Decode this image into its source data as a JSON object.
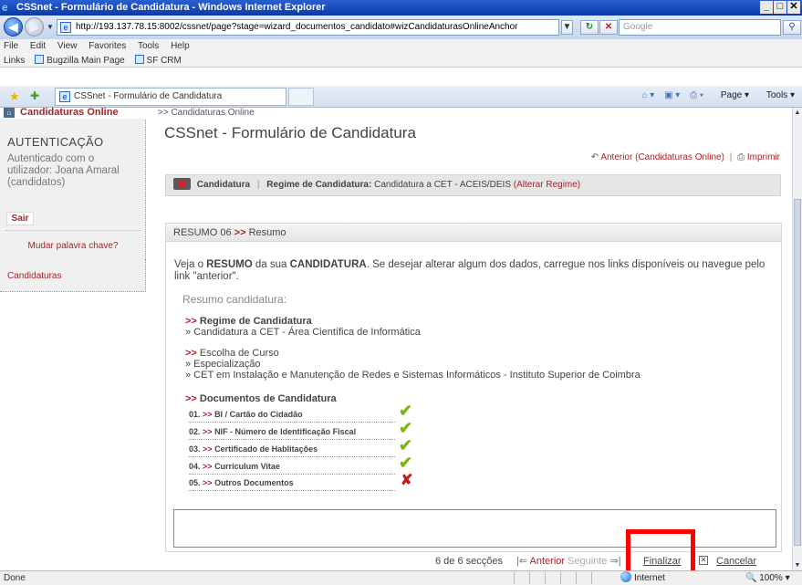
{
  "window": {
    "title": "CSSnet - Formulário de Candidatura - Windows Internet Explorer",
    "buttons": [
      "_",
      "&#x2750;",
      "X"
    ]
  },
  "browser": {
    "url": "http://193.137.78.15:8002/cssnet/page?stage=wizard_documentos_candidato#wizCandidaturasOnlineAnchor",
    "search_placeholder": "Google",
    "menu": [
      "File",
      "Edit",
      "View",
      "Favorites",
      "Tools",
      "Help"
    ],
    "links_label": "Links",
    "links": [
      "Bugzilla Main Page",
      "SF CRM"
    ],
    "tab_title": "CSSnet - Formulário de Candidatura",
    "commands": [
      "Page",
      "Tools"
    ],
    "status_text": "Done",
    "zone": "Internet",
    "zoom": "100%"
  },
  "sidebar": {
    "header": "Candidaturas Online",
    "auth_title": "AUTENTICAÇÃO",
    "auth_text": "Autenticado com o utilizador: Joana Amaral (candidatos)",
    "logout": "Sair",
    "change_password": "Mudar palavra chave?",
    "candidaturas": "Candidaturas"
  },
  "main": {
    "breadcrumb": ">> Candidaturas Online",
    "title": "CSSnet - Formulário de Candidatura",
    "prev_link": "Anterior (Candidaturas Online)",
    "print_link": "Imprimir",
    "regbar": {
      "candidatura": "Candidatura",
      "regime_label": "Regime de Candidatura:",
      "regime_value": "Candidatura a CET - ACEIS/DEIS",
      "change": "(Alterar Regime)"
    },
    "summary": {
      "header_prefix": "RESUMO 06",
      "header_arrows": ">>",
      "header_label": "Resumo",
      "intro_1": "Veja o ",
      "intro_b1": "RESUMO",
      "intro_2": " da sua ",
      "intro_b2": "CANDIDATURA",
      "intro_3": ". Se desejar alterar algum dos dados, carregue nos links disponíveis ou navegue pelo link \"anterior\".",
      "subtitle": "Resumo candidatura:",
      "section1_title": "Regime de Candidatura",
      "section1_items": [
        "» Candidatura a CET - Área Científica de Informática"
      ],
      "section2_title": "Escolha de Curso",
      "section2_items": [
        "» Especialização",
        "» CET em Instalação e Manutenção de Redes e Sistemas Informáticos - Instituto Superior de Coimbra"
      ],
      "section3_title": "Documentos de Candidatura",
      "documents": [
        {
          "num": "01.",
          "label": "BI / Cartão do Cidadão",
          "status": "ok"
        },
        {
          "num": "02.",
          "label": "NIF - Número de Identificação Fiscal",
          "status": "ok"
        },
        {
          "num": "03.",
          "label": "Certificado de Hablitações",
          "status": "ok"
        },
        {
          "num": "04.",
          "label": "Curriculum Vitae",
          "status": "ok"
        },
        {
          "num": "05.",
          "label": "Outros Documentos",
          "status": "missing"
        }
      ]
    },
    "wizard": {
      "count": "6 de 6 secções",
      "prev": "Anterior",
      "next": "Seguinte",
      "finish": "Finalizar",
      "cancel": "Cancelar"
    }
  },
  "colors": {
    "accent": "#a1262b",
    "ok": "#7cb518",
    "missing": "#c21d1d",
    "highlight": "#ff0000"
  }
}
